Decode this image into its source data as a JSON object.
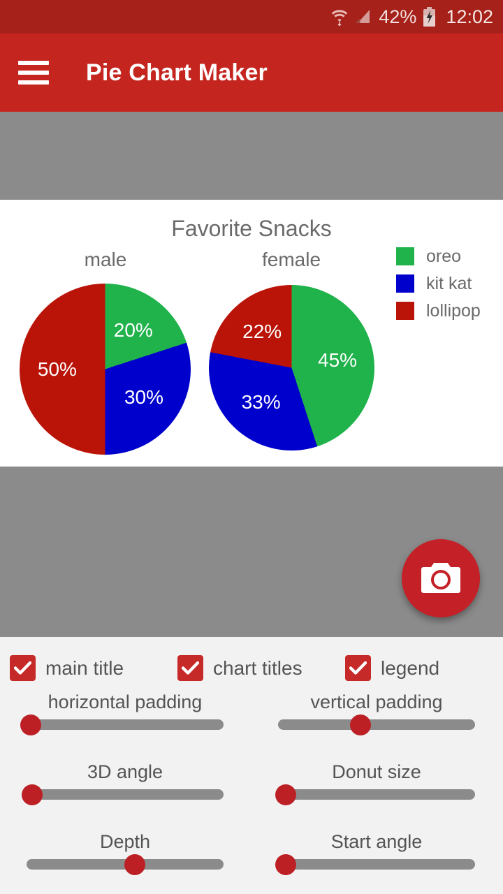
{
  "status_bar": {
    "battery_percent": "42%",
    "clock": "12:02",
    "icons": [
      "wifi-icon",
      "signal-icon",
      "battery-charging-icon"
    ]
  },
  "app_bar": {
    "title": "Pie Chart Maker",
    "menu_icon": "hamburger-menu-icon",
    "background_color": "#c5251f"
  },
  "fab": {
    "icon": "camera-icon",
    "color": "#c42027"
  },
  "chart_data": {
    "type": "pie",
    "title": "Favorite Snacks",
    "legend_position": "right",
    "legend": [
      "oreo",
      "kit kat",
      "lollipop"
    ],
    "colors": {
      "oreo": "#20b24b",
      "kit kat": "#0000cc",
      "lollipop": "#ba1409"
    },
    "charts": [
      {
        "name": "male",
        "categories": [
          "oreo",
          "kit kat",
          "lollipop"
        ],
        "values": [
          20,
          30,
          50
        ],
        "labels": [
          "20%",
          "30%",
          "50%"
        ]
      },
      {
        "name": "female",
        "categories": [
          "oreo",
          "kit kat",
          "lollipop"
        ],
        "values": [
          45,
          33,
          22
        ],
        "labels": [
          "45%",
          "33%",
          "22%"
        ]
      }
    ]
  },
  "controls": {
    "checkboxes": [
      {
        "label": "main title",
        "checked": true
      },
      {
        "label": "chart titles",
        "checked": true
      },
      {
        "label": "legend",
        "checked": true
      }
    ],
    "sliders": [
      {
        "label": "horizontal padding",
        "value_percent": 2
      },
      {
        "label": "vertical padding",
        "value_percent": 42
      },
      {
        "label": "3D angle",
        "value_percent": 3
      },
      {
        "label": "Donut size",
        "value_percent": 4
      },
      {
        "label": "Depth",
        "value_percent": 55
      },
      {
        "label": "Start angle",
        "value_percent": 4
      }
    ]
  }
}
